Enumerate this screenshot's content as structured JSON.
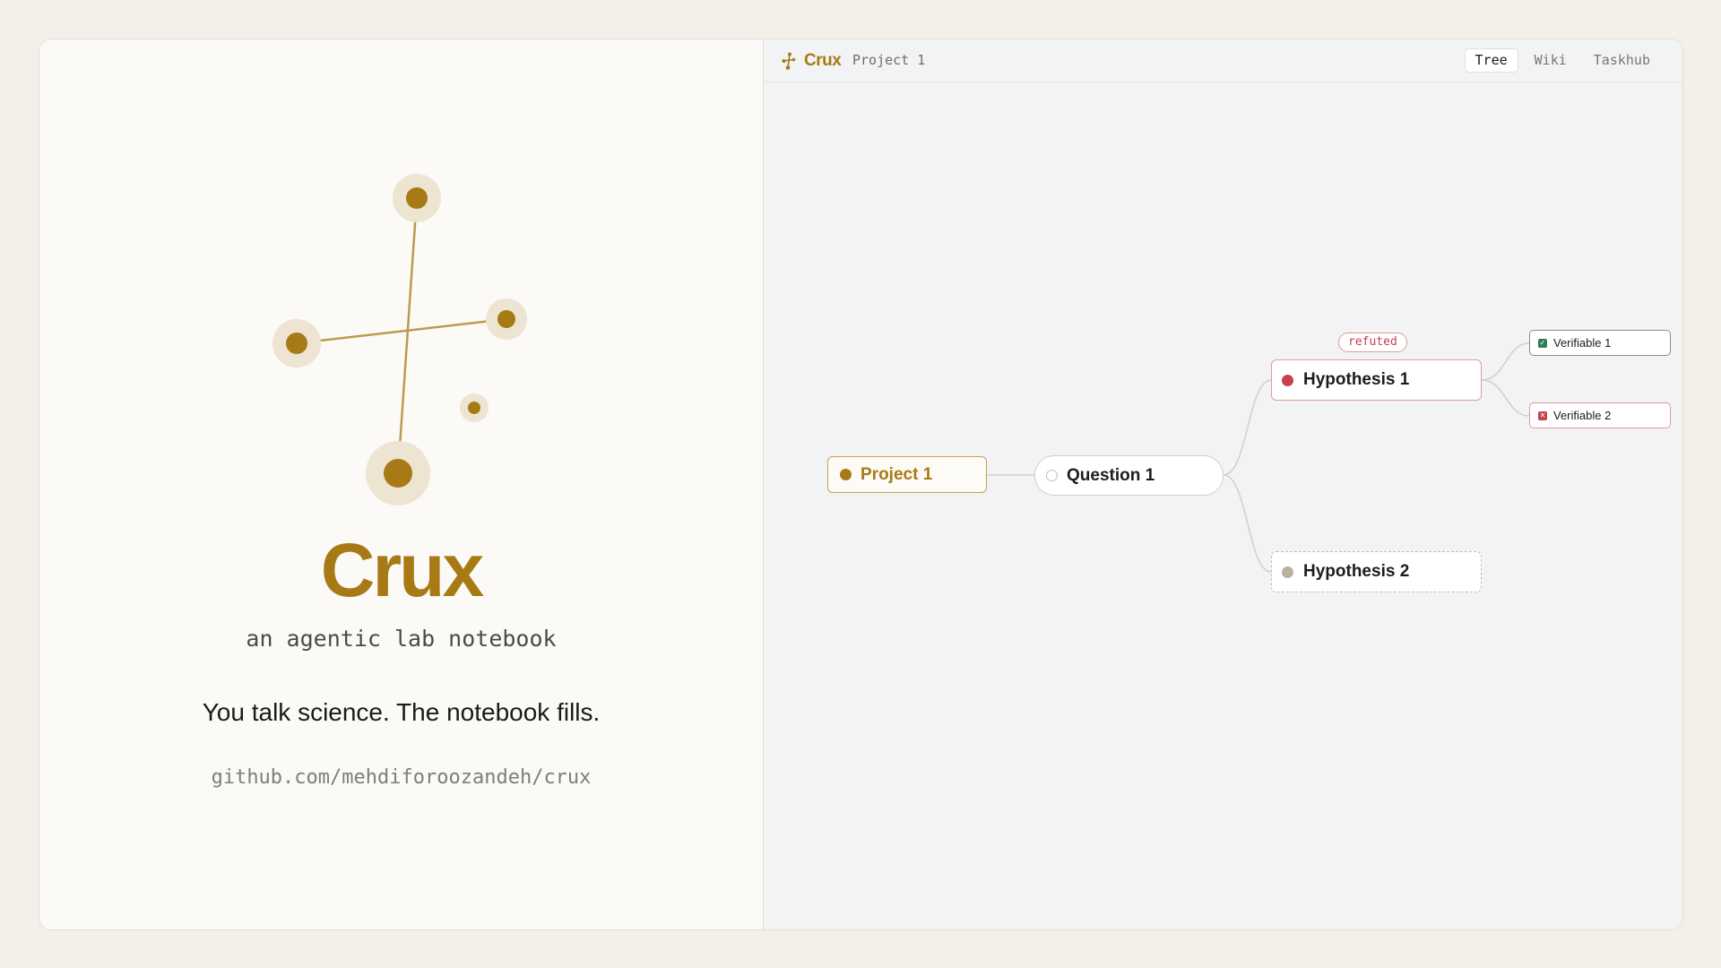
{
  "brand": {
    "title": "Crux",
    "subtitle": "an agentic lab notebook",
    "tagline": "You talk science. The notebook fills.",
    "repo": "github.com/mehdiforoozandeh/crux"
  },
  "topbar": {
    "brand": "Crux",
    "project": "Project 1",
    "tabs": [
      {
        "label": "Tree",
        "active": true
      },
      {
        "label": "Wiki",
        "active": false
      },
      {
        "label": "Taskhub",
        "active": false
      }
    ]
  },
  "tree": {
    "project": {
      "label": "Project 1"
    },
    "question": {
      "label": "Question 1"
    },
    "hypothesis1": {
      "label": "Hypothesis 1",
      "status": "refuted"
    },
    "hypothesis2": {
      "label": "Hypothesis 2"
    },
    "verifiable1": {
      "label": "Verifiable 1",
      "state": "verified"
    },
    "verifiable2": {
      "label": "Verifiable 2",
      "state": "failed"
    }
  },
  "colors": {
    "accent": "#a87a15",
    "refuted": "#c9414d",
    "verified": "#2e7d56",
    "pending": "#b9b0a0"
  }
}
